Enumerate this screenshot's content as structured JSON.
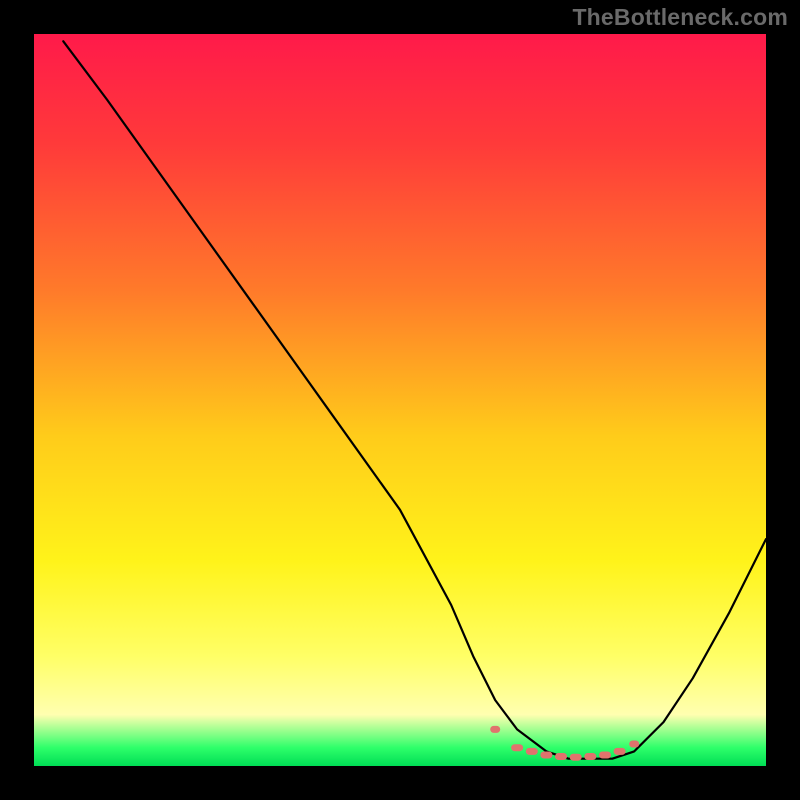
{
  "watermark": "TheBottleneck.com",
  "chart_data": {
    "type": "line",
    "title": "",
    "xlabel": "",
    "ylabel": "",
    "xlim": [
      0,
      100
    ],
    "ylim": [
      0,
      100
    ],
    "series": [
      {
        "name": "curve",
        "color": "#000000",
        "x": [
          4,
          10,
          15,
          20,
          30,
          40,
          50,
          57,
          60,
          63,
          66,
          70,
          73,
          76,
          79,
          82,
          86,
          90,
          95,
          100
        ],
        "y": [
          99,
          91,
          84,
          77,
          63,
          49,
          35,
          22,
          15,
          9,
          5,
          2,
          1,
          1,
          1,
          2,
          6,
          12,
          21,
          31
        ]
      }
    ],
    "markers": {
      "name": "bottom-markers",
      "color": "#e0736d",
      "x": [
        63,
        66,
        68,
        70,
        72,
        74,
        76,
        78,
        80,
        82
      ],
      "y": [
        5,
        2.5,
        2,
        1.5,
        1.3,
        1.2,
        1.3,
        1.5,
        2,
        3
      ]
    },
    "background_gradient": {
      "stops": [
        {
          "offset": 0.0,
          "color": "#ff1a4a"
        },
        {
          "offset": 0.15,
          "color": "#ff3a3a"
        },
        {
          "offset": 0.35,
          "color": "#ff7a2a"
        },
        {
          "offset": 0.55,
          "color": "#ffcc1a"
        },
        {
          "offset": 0.72,
          "color": "#fff31a"
        },
        {
          "offset": 0.85,
          "color": "#ffff66"
        },
        {
          "offset": 0.93,
          "color": "#ffffb0"
        },
        {
          "offset": 0.975,
          "color": "#2eff6a"
        },
        {
          "offset": 1.0,
          "color": "#00dd55"
        }
      ]
    },
    "frame_color": "#000000",
    "frame_thickness_px": 34
  }
}
